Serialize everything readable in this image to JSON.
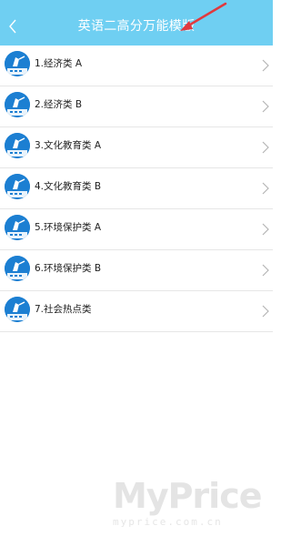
{
  "header": {
    "title": "英语二高分万能模版",
    "back_icon": "chevron-left-icon",
    "background": "#6fcff2"
  },
  "list": {
    "items": [
      {
        "label": "1.经济类 A",
        "icon": "course-avatar-icon"
      },
      {
        "label": "2.经济类 B",
        "icon": "course-avatar-icon"
      },
      {
        "label": "3.文化教育类 A",
        "icon": "course-avatar-icon"
      },
      {
        "label": "4.文化教育类 B",
        "icon": "course-avatar-icon"
      },
      {
        "label": "5.环境保护类 A",
        "icon": "course-avatar-icon"
      },
      {
        "label": "6.环境保护类 B",
        "icon": "course-avatar-icon"
      },
      {
        "label": "7.社会热点类",
        "icon": "course-avatar-icon"
      }
    ],
    "chevron_icon": "chevron-right-icon"
  },
  "watermark": {
    "brand": "MyPrice",
    "url": "myprice.com.cn"
  },
  "colors": {
    "accent": "#6fcff2",
    "avatar": "#1c7fd2",
    "annotation_arrow": "#e0393e"
  }
}
